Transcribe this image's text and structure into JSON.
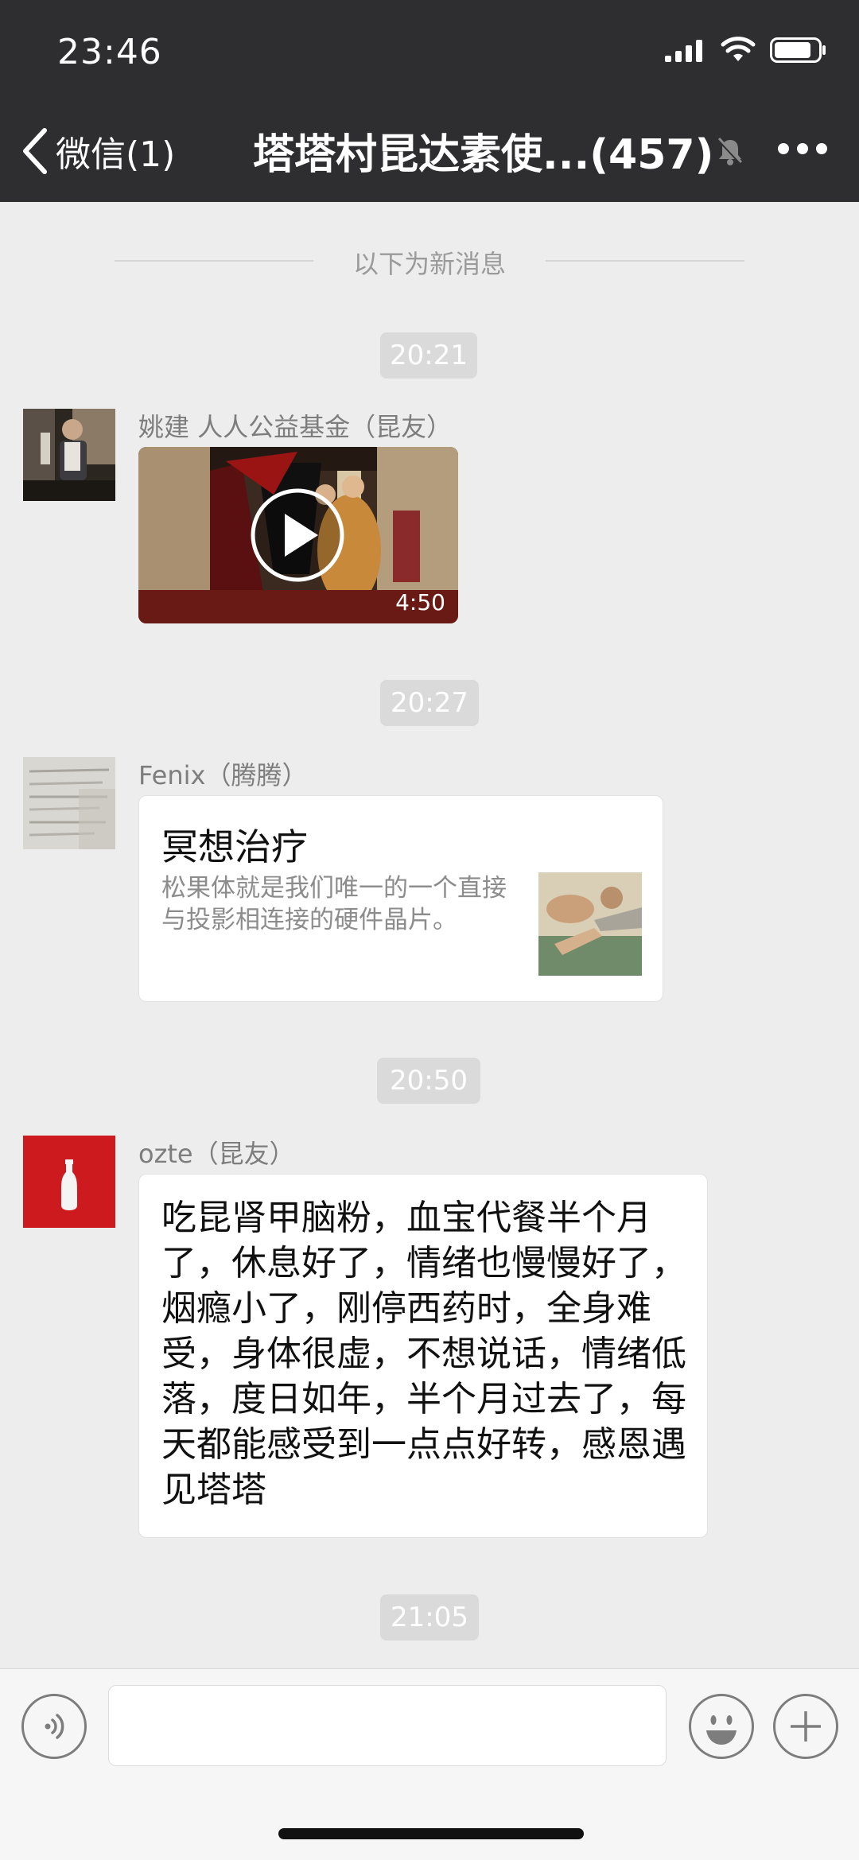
{
  "status_bar": {
    "time": "23:46",
    "icons": [
      "signal-icon",
      "wifi-icon",
      "battery-icon"
    ]
  },
  "nav": {
    "back_label": "微信(1)",
    "title": "塔塔村昆达素使...(457)",
    "icons": [
      "back-chevron-icon",
      "mute-bell-icon",
      "more-icon"
    ]
  },
  "divider": {
    "label": "以下为新消息"
  },
  "messages": [
    {
      "time": "20:21",
      "sender": "姚建  人人公益基金（昆友）",
      "type": "video",
      "duration": "4:50"
    },
    {
      "time": "20:27",
      "sender": "Fenix（腾腾）",
      "type": "link",
      "title": "冥想治疗",
      "description": "松果体就是我们唯一的一个直接与投影相连接的硬件晶片。"
    },
    {
      "time": "20:50",
      "sender": "ozte（昆友）",
      "type": "text",
      "text": "吃昆肾甲脑粉，血宝代餐半个月了，休息好了，情绪也慢慢好了，烟瘾小了，刚停西药时，全身难受，身体很虚，不想说话，情绪低落，度日如年，半个月过去了，每天都能感受到一点点好转，感恩遇见塔塔"
    },
    {
      "time": "21:05"
    }
  ],
  "input_bar": {
    "icons": [
      "voice-icon",
      "emoji-icon",
      "plus-icon"
    ],
    "input_value": ""
  },
  "colors": {
    "header_bg": "#2e2e30",
    "chat_bg": "#ededed",
    "bubble_bg": "#ffffff",
    "time_pill_bg": "#dadada"
  }
}
